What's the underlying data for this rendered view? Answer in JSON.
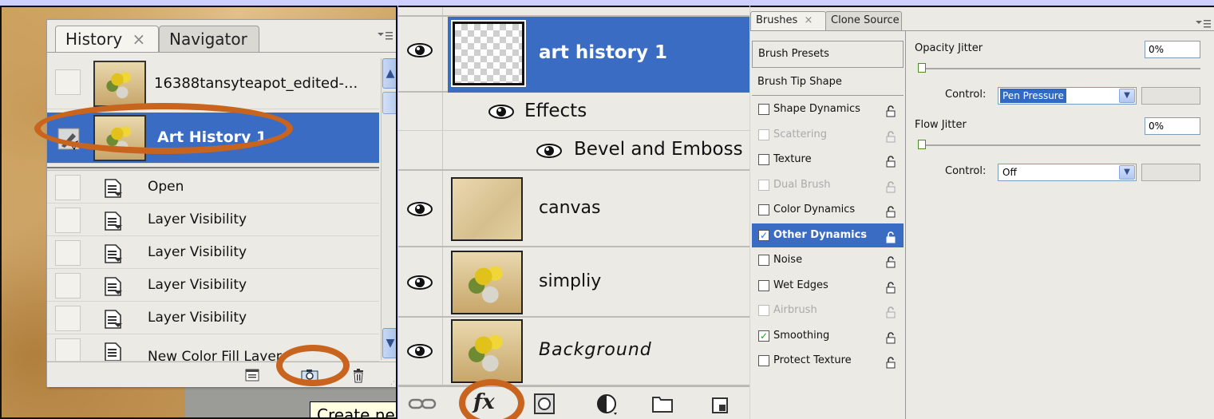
{
  "history_panel": {
    "tabs": [
      {
        "label": "History",
        "close": "×"
      },
      {
        "label": "Navigator"
      }
    ],
    "snapshots": [
      {
        "label": "16388tansyteapot_edited-..."
      },
      {
        "label": "Art History 1",
        "selected": true
      }
    ],
    "states": [
      {
        "label": "Open"
      },
      {
        "label": "Layer Visibility"
      },
      {
        "label": "Layer Visibility"
      },
      {
        "label": "Layer Visibility"
      },
      {
        "label": "Layer Visibility"
      },
      {
        "label": "New Color Fill Layer"
      }
    ],
    "footer_icons": [
      "new-document-icon",
      "camera-icon",
      "trash-icon"
    ],
    "tooltip": "Create new snapshot"
  },
  "layers_panel": {
    "layers": [
      {
        "name": "art history 1",
        "selected": true,
        "has_effects": true
      },
      {
        "name": "canvas"
      },
      {
        "name": "simpliy"
      },
      {
        "name": "Background",
        "italic": true
      }
    ],
    "effects_label": "Effects",
    "effect_items": [
      "Bevel and Emboss"
    ],
    "footer_icons": [
      "link-icon",
      "fx-icon",
      "mask-icon",
      "adjustment-icon",
      "folder-icon",
      "new-layer-icon"
    ],
    "fx_label": "fx"
  },
  "brushes_panel": {
    "tabs": [
      {
        "label": "Brushes",
        "close": "×"
      },
      {
        "label": "Clone Source"
      }
    ],
    "presets_label": "Brush Presets",
    "tip_shape_label": "Brush Tip Shape",
    "options": [
      {
        "label": "Shape Dynamics",
        "checked": false,
        "enabled": true
      },
      {
        "label": "Scattering",
        "checked": false,
        "enabled": false
      },
      {
        "label": "Texture",
        "checked": false,
        "enabled": true
      },
      {
        "label": "Dual Brush",
        "checked": false,
        "enabled": false
      },
      {
        "label": "Color Dynamics",
        "checked": false,
        "enabled": true
      },
      {
        "label": "Other Dynamics",
        "checked": true,
        "enabled": true,
        "selected": true
      },
      {
        "label": "Noise",
        "checked": false,
        "enabled": true
      },
      {
        "label": "Wet Edges",
        "checked": false,
        "enabled": true
      },
      {
        "label": "Airbrush",
        "checked": false,
        "enabled": false
      },
      {
        "label": "Smoothing",
        "checked": true,
        "enabled": true
      },
      {
        "label": "Protect Texture",
        "checked": false,
        "enabled": true
      }
    ],
    "opacity_jitter": {
      "label": "Opacity Jitter",
      "value": "0%"
    },
    "opacity_control": {
      "label": "Control:",
      "value": "Pen Pressure"
    },
    "flow_jitter": {
      "label": "Flow Jitter",
      "value": "0%"
    },
    "flow_control": {
      "label": "Control:",
      "value": "Off"
    }
  },
  "colors": {
    "selection_blue": "#3a6cc4",
    "highlight_ring": "#c8641e",
    "page_background": "#cccfff"
  }
}
